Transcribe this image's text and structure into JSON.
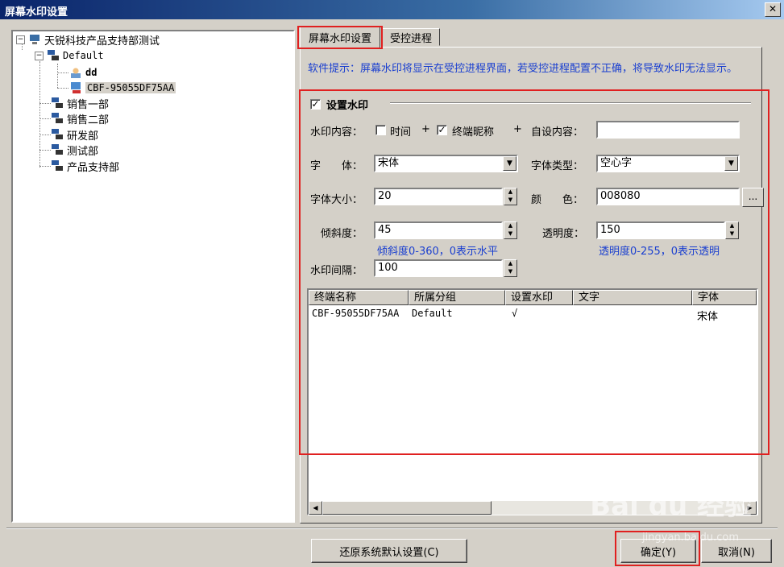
{
  "window": {
    "title": "屏幕水印设置",
    "close_glyph": "✕"
  },
  "tree": {
    "root": "天锐科技产品支持部测试",
    "default_group": "Default",
    "user": "dd",
    "computer": "CBF-95055DF75AA",
    "groups": [
      "销售一部",
      "销售二部",
      "研发部",
      "测试部",
      "产品支持部"
    ],
    "expander_glyph": "−"
  },
  "tabs": {
    "watermark": "屏幕水印设置",
    "process": "受控进程"
  },
  "hint": "软件提示：屏幕水印将显示在受控进程界面，若受控进程配置不正确，将导致水印无法显示。",
  "form": {
    "enable_label": "设置水印",
    "enable_checked": true,
    "content_label": "水印内容：",
    "time_label": "时间",
    "time_checked": false,
    "plus": "+",
    "nickname_label": "终端昵称",
    "nickname_checked": true,
    "custom_label": "自设内容：",
    "custom_value": "",
    "font_label": "字　　体：",
    "font_value": "宋体",
    "font_type_label": "字体类型：",
    "font_type_value": "空心字",
    "font_size_label": "字体大小：",
    "font_size_value": "20",
    "color_label": "颜　　色：",
    "color_value": "008080",
    "color_btn": "...",
    "tilt_label": "倾斜度：",
    "tilt_value": "45",
    "tilt_note": "倾斜度0-360，0表示水平",
    "opacity_label": "透明度：",
    "opacity_value": "150",
    "opacity_note": "透明度0-255，0表示透明",
    "spacing_label": "水印间隔：",
    "spacing_value": "100",
    "check_glyph": "✓",
    "dropdown_glyph": "▼",
    "spin_up": "▲",
    "spin_down": "▼"
  },
  "list": {
    "columns": [
      "终端名称",
      "所属分组",
      "设置水印",
      "文字",
      "字体"
    ],
    "rows": [
      {
        "name": "CBF-95055DF75AA",
        "group": "Default",
        "watermark": "√",
        "text": "",
        "font": "宋体"
      }
    ],
    "scroll_left": "◀",
    "scroll_right": "▶"
  },
  "buttons": {
    "restore": "还原系统默认设置(C)",
    "ok": "确定(Y)",
    "cancel": "取消(N)"
  },
  "watermark": {
    "logo": "Bai du 经验",
    "url": "jingyan.baidu.com"
  },
  "colors": {
    "highlight": "#e02020",
    "hint_text": "#1a3fd0",
    "title_bar": "#0a246a"
  }
}
